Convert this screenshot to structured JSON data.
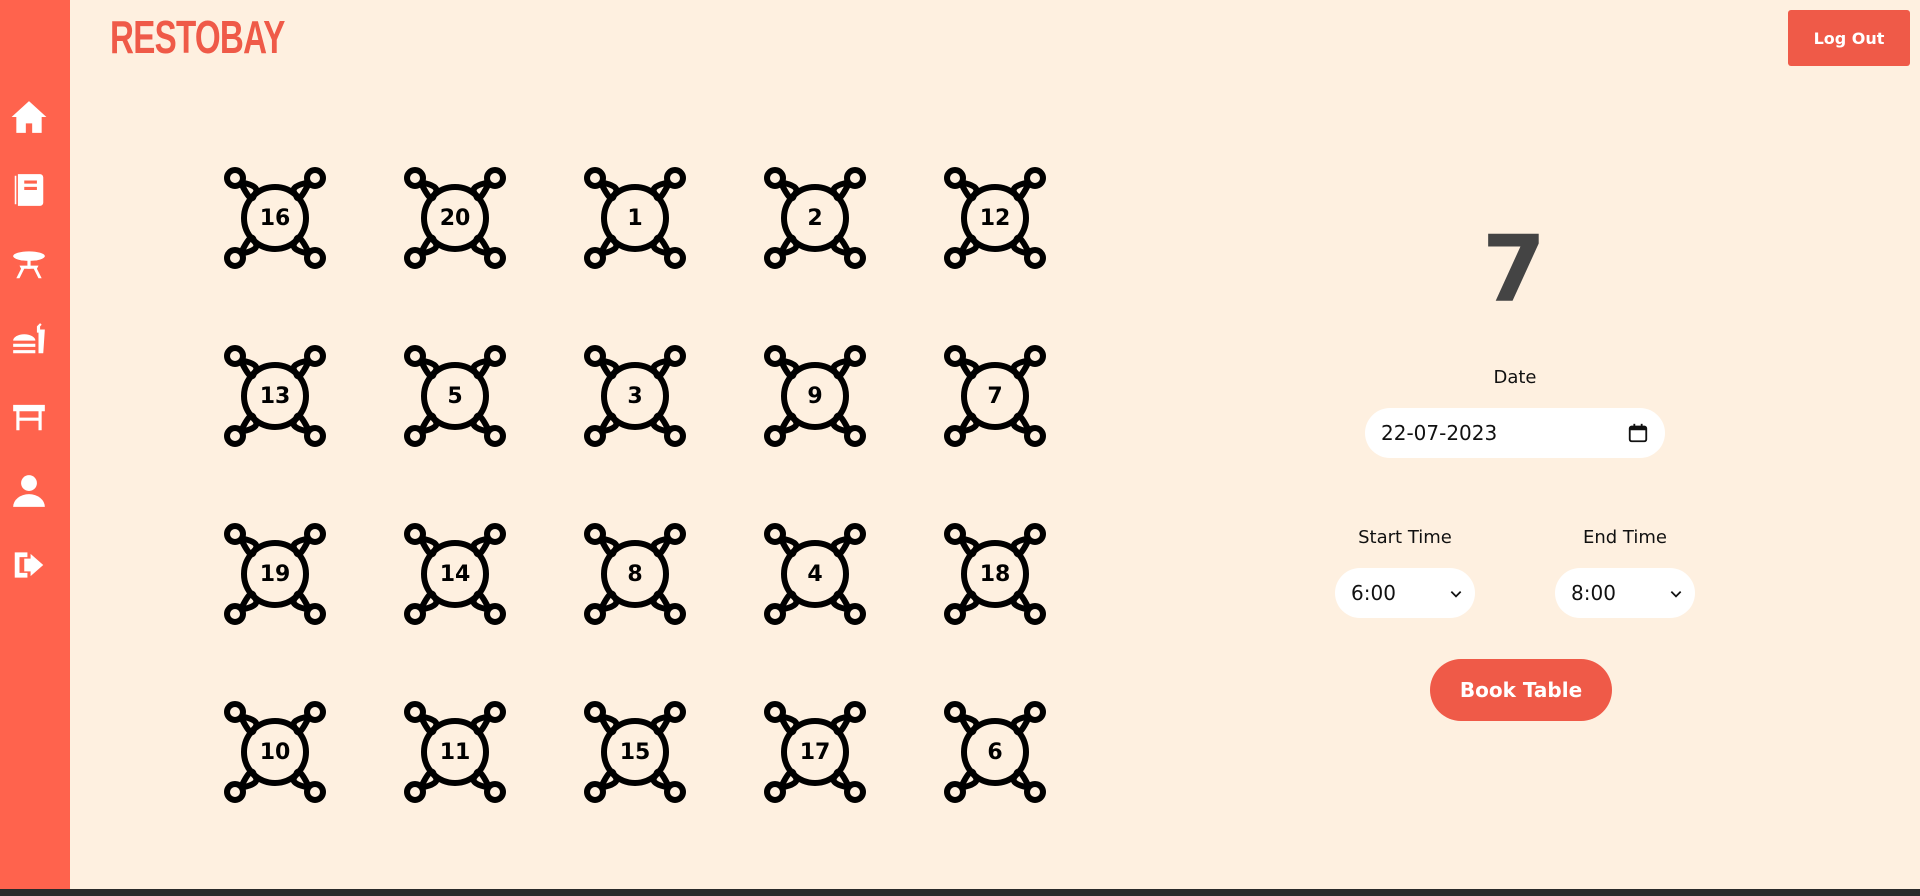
{
  "brand": {
    "logo": "RESTOBAY",
    "accent": "#ef5a48",
    "sidebar_color": "#ff634d",
    "background": "#fef0e0"
  },
  "header": {
    "logout_label": "Log Out"
  },
  "sidebar": {
    "icons": [
      "home-icon",
      "menu-book-icon",
      "dining-table-icon",
      "food-icon",
      "table-icon",
      "user-icon",
      "sign-out-icon"
    ]
  },
  "tables": {
    "rows": [
      [
        "16",
        "20",
        "1",
        "2",
        "12"
      ],
      [
        "13",
        "5",
        "3",
        "9",
        "7"
      ],
      [
        "19",
        "14",
        "8",
        "4",
        "18"
      ],
      [
        "10",
        "11",
        "15",
        "17",
        "6"
      ]
    ]
  },
  "booking": {
    "selected_table": "7",
    "date_label": "Date",
    "date_value": "22-07-2023",
    "start_label": "Start Time",
    "start_value": "6:00",
    "end_label": "End Time",
    "end_value": "8:00",
    "book_label": "Book Table"
  }
}
